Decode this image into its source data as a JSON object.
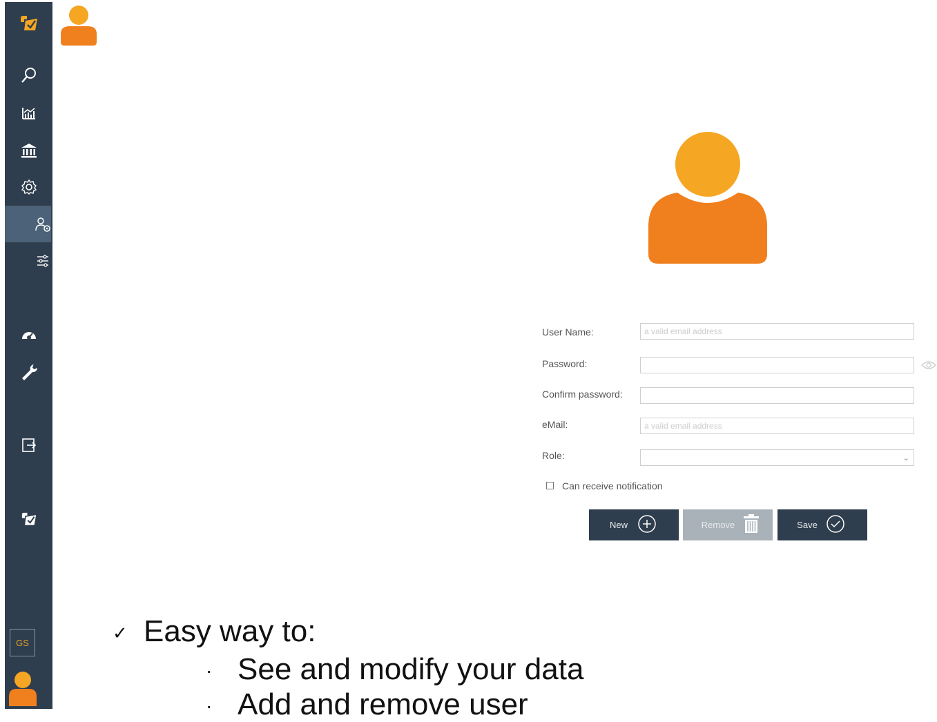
{
  "sidebar": {
    "badge": "GS",
    "items": [
      {
        "icon": "app-logo-icon"
      },
      {
        "icon": "search-icon"
      },
      {
        "icon": "chart-icon"
      },
      {
        "icon": "bank-icon"
      },
      {
        "icon": "gear-icon"
      },
      {
        "icon": "user-settings-icon",
        "active": true
      },
      {
        "icon": "sliders-icon"
      },
      {
        "icon": "speedometer-icon"
      },
      {
        "icon": "wrench-icon"
      },
      {
        "icon": "logout-icon"
      },
      {
        "icon": "app-logo-icon"
      }
    ]
  },
  "form": {
    "username_label": "User Name:",
    "username_placeholder": "a valid email address",
    "password_label": "Password:",
    "confirm_label": "Confirm password:",
    "email_label": "eMail:",
    "email_placeholder": "a valid email address",
    "role_label": "Role:",
    "role_value": "",
    "notify_label": "Can receive notification",
    "notify_checked": false
  },
  "buttons": {
    "new_label": "New",
    "remove_label": "Remove",
    "save_label": "Save"
  },
  "bullets": {
    "main": "Easy way to:",
    "sub1": "See and modify your data",
    "sub2": "Add and remove user"
  },
  "colors": {
    "sidebar": "#2f3e4e",
    "avatar_head": "#f5a623",
    "avatar_body": "#f0801e"
  }
}
